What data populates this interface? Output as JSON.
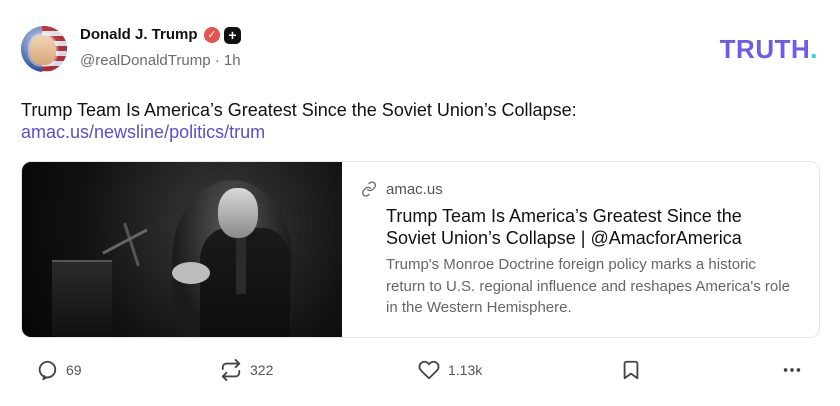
{
  "author": {
    "name": "Donald J. Trump",
    "handle": "@realDonaldTrump",
    "time_sep": "·",
    "time": "1h",
    "verified_icon": "check-badge-icon",
    "plus_icon": "plus-badge-icon"
  },
  "brand": {
    "logo_text": "TRUTH",
    "logo_dot": ".",
    "accent": "#6c5ce7",
    "dot_color": "#33d6c8"
  },
  "post": {
    "text": "Trump Team Is America’s Greatest Since the Soviet Union’s Collapse:",
    "link": "amac.us/newsline/politics/trum"
  },
  "card": {
    "domain": "amac.us",
    "title": "Trump Team Is America’s Greatest Since the Soviet Union’s Collapse | @AmacforAmerica",
    "description": "Trump's Monroe Doctrine foreign policy marks a historic return to U.S. regional influence and reshapes America's role in the Western Hemisphere.",
    "image_desc_icon": "news-photo-icon"
  },
  "actions": {
    "replies": "69",
    "retruths": "322",
    "likes": "1.13k"
  }
}
